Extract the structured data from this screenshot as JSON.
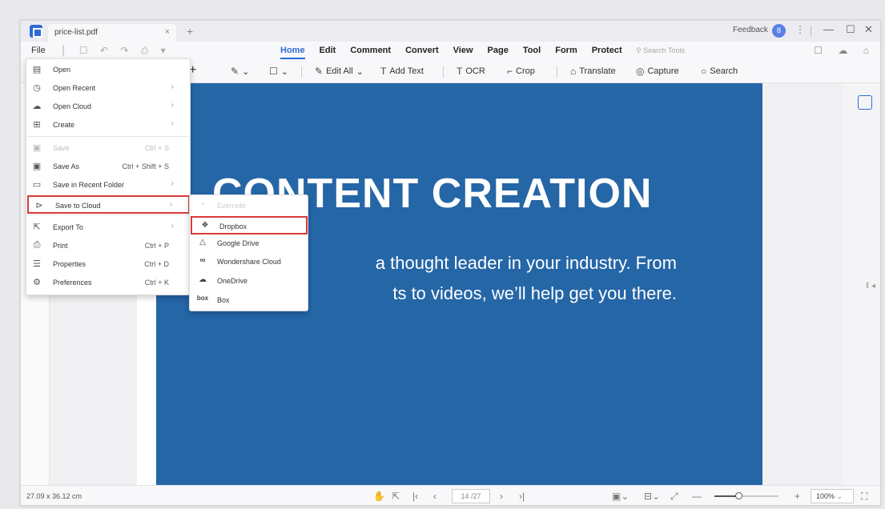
{
  "window": {
    "tab_title": "price-list.pdf",
    "tab_close": "×",
    "tab_add": "+",
    "feedback": "Feedback",
    "avatar": "8"
  },
  "menubar": {
    "file": "File",
    "tabs": [
      "Home",
      "Edit",
      "Comment",
      "Convert",
      "View",
      "Page",
      "Tool",
      "Form",
      "Protect"
    ],
    "active_tab": "Home",
    "search_tools": "Search Tools"
  },
  "toolbar": {
    "edit_all": "Edit All",
    "add_text": "Add Text",
    "ocr": "OCR",
    "crop": "Crop",
    "translate": "Translate",
    "capture": "Capture",
    "search": "Search"
  },
  "document": {
    "title": "CONTENT CREATION",
    "subtitle_line1": "a thought leader in your industry. From",
    "subtitle_line2": "ts to videos, we’ll help get you there."
  },
  "file_menu": {
    "items": [
      {
        "label": "Open",
        "icon": "open-icon",
        "shortcut": "",
        "arrow": false,
        "disabled": false
      },
      {
        "label": "Open Recent",
        "icon": "clock-icon",
        "shortcut": "",
        "arrow": true,
        "disabled": false
      },
      {
        "label": "Open Cloud",
        "icon": "cloud-icon",
        "shortcut": "",
        "arrow": true,
        "disabled": false
      },
      {
        "label": "Create",
        "icon": "create-icon",
        "shortcut": "",
        "arrow": true,
        "disabled": false
      },
      {
        "label": "Save",
        "icon": "save-icon",
        "shortcut": "Ctrl + S",
        "arrow": false,
        "disabled": true
      },
      {
        "label": "Save As",
        "icon": "save-as-icon",
        "shortcut": "Ctrl + Shift + S",
        "arrow": false,
        "disabled": false
      },
      {
        "label": "Save in Recent Folder",
        "icon": "folder-icon",
        "shortcut": "",
        "arrow": true,
        "disabled": false
      },
      {
        "label": "Save to Cloud",
        "icon": "share-icon",
        "shortcut": "",
        "arrow": true,
        "disabled": false,
        "highlight": true
      },
      {
        "label": "Export To",
        "icon": "export-icon",
        "shortcut": "",
        "arrow": true,
        "disabled": false
      },
      {
        "label": "Print",
        "icon": "print-icon",
        "shortcut": "Ctrl + P",
        "arrow": false,
        "disabled": false
      },
      {
        "label": "Properties",
        "icon": "properties-icon",
        "shortcut": "Ctrl + D",
        "arrow": false,
        "disabled": false
      },
      {
        "label": "Preferences",
        "icon": "preferences-icon",
        "shortcut": "Ctrl + K",
        "arrow": false,
        "disabled": false
      }
    ]
  },
  "cloud_submenu": {
    "items": [
      {
        "label": "Evernote",
        "icon": "evernote-icon",
        "disabled": true
      },
      {
        "label": "Dropbox",
        "icon": "dropbox-icon",
        "disabled": false,
        "highlight": true
      },
      {
        "label": "Google Drive",
        "icon": "google-drive-icon",
        "disabled": false
      },
      {
        "label": "Wondershare Cloud",
        "icon": "wondershare-cloud-icon",
        "disabled": false
      },
      {
        "label": "OneDrive",
        "icon": "onedrive-icon",
        "disabled": false
      },
      {
        "label": "Box",
        "icon": "box-icon",
        "disabled": false
      }
    ]
  },
  "statusbar": {
    "dimensions": "27.09 x 36.12 cm",
    "page_indicator": "14 /27",
    "zoom": "100%",
    "zoom_fraction": 0.38
  },
  "colors": {
    "accent": "#2c6cd6",
    "page_bg": "#2566a7",
    "highlight_border": "#d83a3a"
  }
}
